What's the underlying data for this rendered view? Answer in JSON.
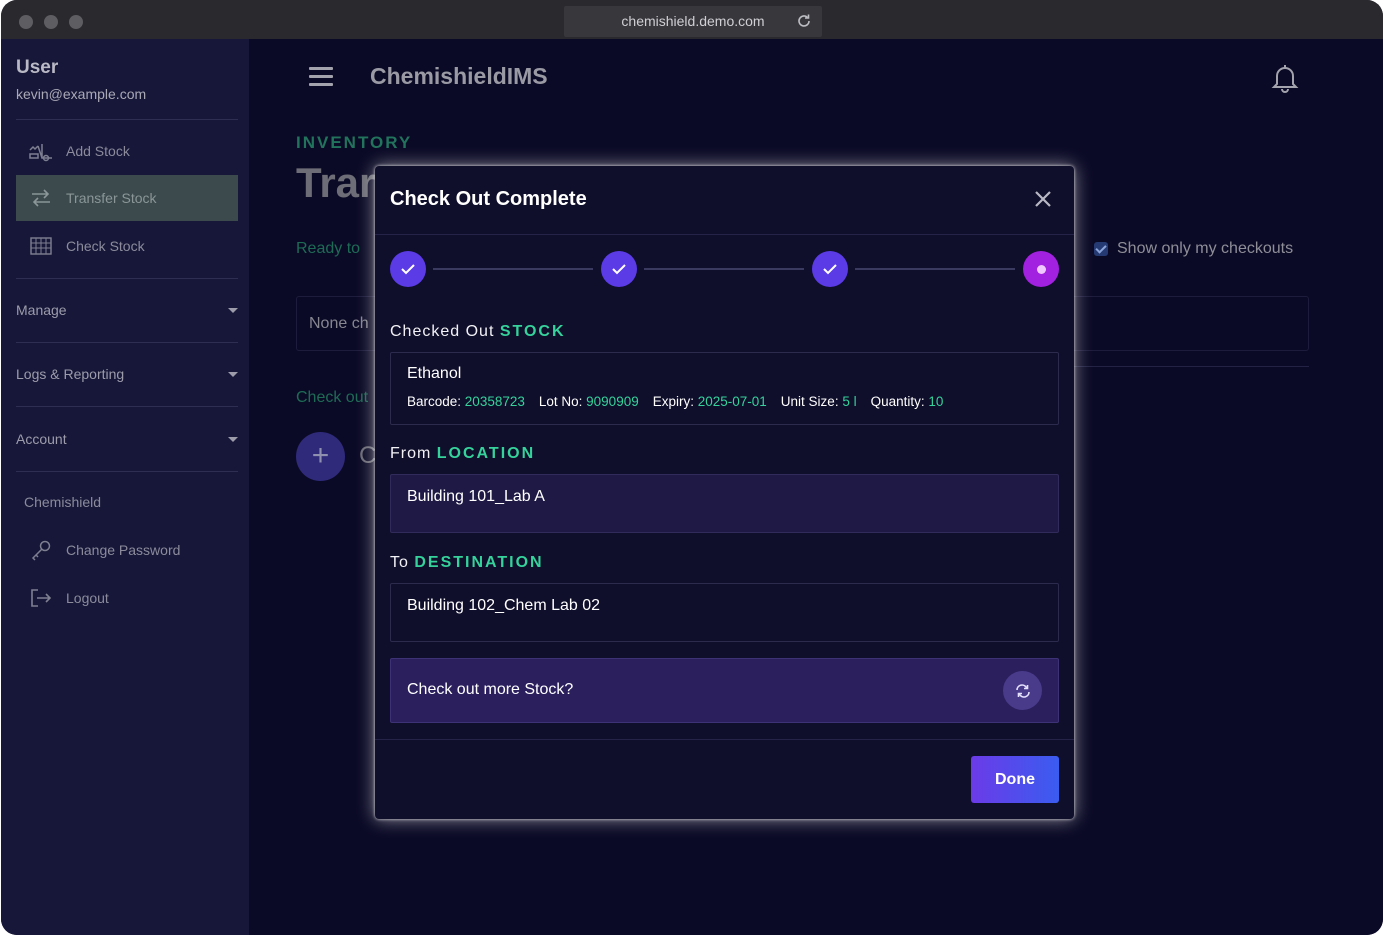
{
  "browser": {
    "url": "chemishield.demo.com"
  },
  "sidebar": {
    "user_name": "User",
    "user_email": "kevin@example.com",
    "items": [
      {
        "label": "Add Stock",
        "icon": "forklift-icon"
      },
      {
        "label": "Transfer Stock",
        "icon": "transfer-arrows-icon",
        "active": true
      },
      {
        "label": "Check Stock",
        "icon": "grid-icon"
      }
    ],
    "groups": [
      {
        "label": "Manage"
      },
      {
        "label": "Logs & Reporting"
      },
      {
        "label": "Account"
      }
    ],
    "section_label": "Chemishield",
    "account_items": [
      {
        "label": "Change Password",
        "icon": "key-icon"
      },
      {
        "label": "Logout",
        "icon": "logout-icon"
      }
    ]
  },
  "header": {
    "app_title": "ChemishieldIMS"
  },
  "main": {
    "section_label": "INVENTORY",
    "title_fragment": "Trar",
    "ready_fragment": "Ready to",
    "show_mine_label": "Show only my checkouts",
    "none_fragment": "None ch",
    "checkout_fragment": "Check out",
    "c_fragment": "C"
  },
  "modal": {
    "title": "Check Out Complete",
    "steps": [
      {
        "state": "complete"
      },
      {
        "state": "complete"
      },
      {
        "state": "complete"
      },
      {
        "state": "current"
      }
    ],
    "stock": {
      "prefix": "Checked Out ",
      "accent": "STOCK",
      "name": "Ethanol",
      "barcode_label": "Barcode: ",
      "barcode": "20358723",
      "lot_label": "Lot No: ",
      "lot": "9090909",
      "expiry_label": "Expiry: ",
      "expiry": "2025-07-01",
      "unit_label": "Unit Size: ",
      "unit": "5 l",
      "qty_label": "Quantity: ",
      "qty": "10"
    },
    "from": {
      "prefix": "From ",
      "accent": "LOCATION",
      "value": "Building 101_Lab A"
    },
    "to": {
      "prefix": "To ",
      "accent": "DESTINATION",
      "value": "Building 102_Chem Lab 02"
    },
    "more_label": "Check out more Stock?",
    "done_label": "Done"
  },
  "colors": {
    "accent_green": "#35d39b",
    "step_purple": "#5b3be6",
    "step_current": "#a220e0",
    "done_gradient_start": "#6b3be8",
    "done_gradient_end": "#3a5cf0"
  }
}
